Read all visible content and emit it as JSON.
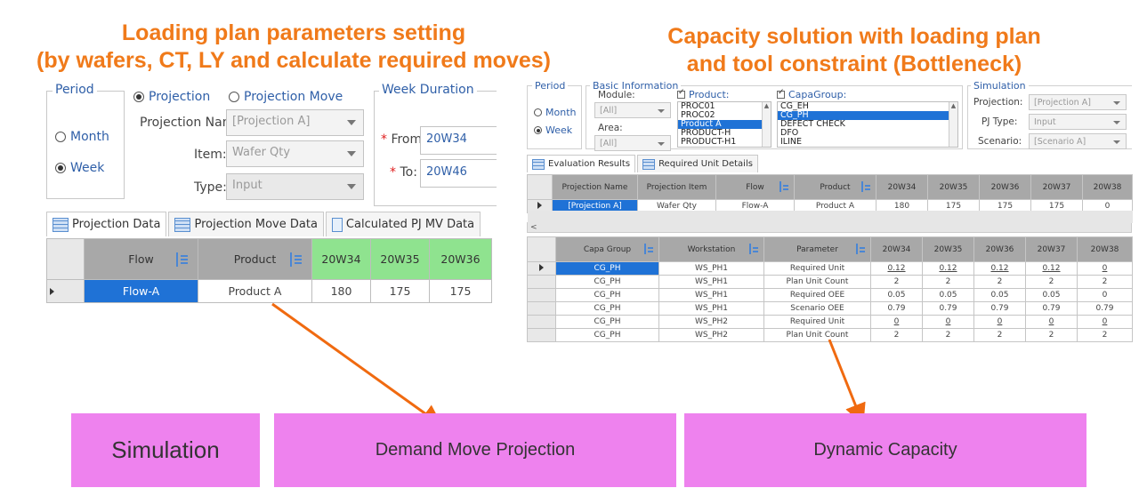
{
  "headings": {
    "left_line1": "Loading plan parameters setting",
    "left_line2": "(by wafers, CT, LY and calculate required moves)",
    "right_line1": "Capacity solution with loading plan",
    "right_line2": "and tool constraint (Bottleneck)"
  },
  "left_panel": {
    "period_legend": "Period",
    "month_label": "Month",
    "week_label": "Week",
    "projection_label": "Projection",
    "projection_move_label": "Projection Move",
    "projection_name_label": "Projection Name:",
    "projection_name_value": "[Projection A]",
    "item_label": "Item:",
    "item_value": "Wafer Qty",
    "type_label": "Type:",
    "type_value": "Input",
    "week_duration_legend": "Week Duration",
    "from_label": "From:",
    "from_value": "20W34",
    "to_label": "To:",
    "to_value": "20W46",
    "tabs": [
      "Projection Data",
      "Projection Move Data",
      "Calculated PJ MV Data"
    ],
    "table": {
      "headers": [
        "Flow",
        "Product",
        "20W34",
        "20W35",
        "20W36"
      ],
      "row": [
        "Flow-A",
        "Product A",
        "180",
        "175",
        "175"
      ]
    }
  },
  "right_panel": {
    "period_legend": "Period",
    "month_label": "Month",
    "week_label": "Week",
    "basic_info_legend": "Basic Information",
    "module_label": "Module:",
    "module_value": "[All]",
    "area_label": "Area:",
    "area_value": "[All]",
    "product_label": "Product:",
    "product_items": [
      "PROC01",
      "PROC02",
      "Product A",
      "PRODUCT-H",
      "PRODUCT-H1"
    ],
    "capagroup_label": "CapaGroup:",
    "capagroup_items": [
      "CG_EH",
      "CG_PH",
      "DEFECT CHECK",
      "DFO",
      "ILINE"
    ],
    "simulation_legend": "Simulation",
    "projection_label": "Projection:",
    "projection_value": "[Projection A]",
    "pj_type_label": "PJ Type:",
    "pj_type_value": "Input",
    "scenario_label": "Scenario:",
    "scenario_value": "[Scenario A]",
    "tabs": [
      "Evaluation Results",
      "Required Unit Details"
    ],
    "table1": {
      "headers": [
        "Projection Name",
        "Projection Item",
        "Flow",
        "Product",
        "20W34",
        "20W35",
        "20W36",
        "20W37",
        "20W38"
      ],
      "row": [
        "[Projection A]",
        "Wafer Qty",
        "Flow-A",
        "Product A",
        "180",
        "175",
        "175",
        "175",
        "0"
      ]
    },
    "scroll_left": "<",
    "table2": {
      "headers": [
        "Capa Group",
        "Workstation",
        "Parameter",
        "20W34",
        "20W35",
        "20W36",
        "20W37",
        "20W38"
      ],
      "rows": [
        [
          "CG_PH",
          "WS_PH1",
          "Required Unit",
          "0.12",
          "0.12",
          "0.12",
          "0.12",
          "0"
        ],
        [
          "CG_PH",
          "WS_PH1",
          "Plan Unit Count",
          "2",
          "2",
          "2",
          "2",
          "2"
        ],
        [
          "CG_PH",
          "WS_PH1",
          "Required OEE",
          "0.05",
          "0.05",
          "0.05",
          "0.05",
          "0"
        ],
        [
          "CG_PH",
          "WS_PH1",
          "Scenario OEE",
          "0.79",
          "0.79",
          "0.79",
          "0.79",
          "0.79"
        ],
        [
          "CG_PH",
          "WS_PH2",
          "Required Unit",
          "0",
          "0",
          "0",
          "0",
          "0"
        ],
        [
          "CG_PH",
          "WS_PH2",
          "Plan Unit Count",
          "2",
          "2",
          "2",
          "2",
          "2"
        ]
      ]
    }
  },
  "boxes": {
    "simulation": "Simulation",
    "demand_move_projection": "Demand Move Projection",
    "dynamic_capacity": "Dynamic Capacity"
  },
  "colors": {
    "heading_orange": "#f07a1a",
    "box_magenta": "#ee82ee",
    "selection_blue": "#1f72d6",
    "header_green": "#8fe38f",
    "legend_blue": "#2f5fa8"
  }
}
